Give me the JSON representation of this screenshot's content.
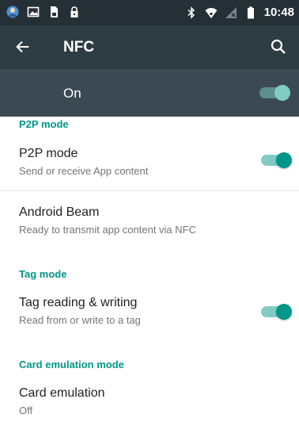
{
  "status_bar": {
    "time": "10:48",
    "left_icons": [
      "avatar-icon",
      "image-icon",
      "sim-card-icon",
      "lock-icon"
    ],
    "right_icons": [
      "bluetooth-icon",
      "wifi-icon",
      "no-signal-icon",
      "battery-icon"
    ]
  },
  "toolbar": {
    "title": "NFC",
    "back_icon": "arrow-left-icon",
    "search_icon": "search-icon"
  },
  "master_switch": {
    "label": "On",
    "checked": true
  },
  "sections": {
    "p2p": {
      "header": "P2P mode",
      "items": [
        {
          "title": "P2P mode",
          "summary": "Send or receive App content",
          "checked": true
        },
        {
          "title": "Android Beam",
          "summary": "Ready to transmit app content via NFC"
        }
      ]
    },
    "tag": {
      "header": "Tag mode",
      "items": [
        {
          "title": "Tag reading & writing",
          "summary": "Read from or write to a tag",
          "checked": true
        }
      ]
    },
    "card": {
      "header": "Card emulation mode",
      "items": [
        {
          "title": "Card emulation",
          "summary": "Off"
        }
      ]
    }
  },
  "colors": {
    "status_bar_bg": "#253036",
    "toolbar_bg": "#2e3c43",
    "master_bar_bg": "#3b4a52",
    "accent": "#009688",
    "switch_track": "#80cbc4"
  }
}
